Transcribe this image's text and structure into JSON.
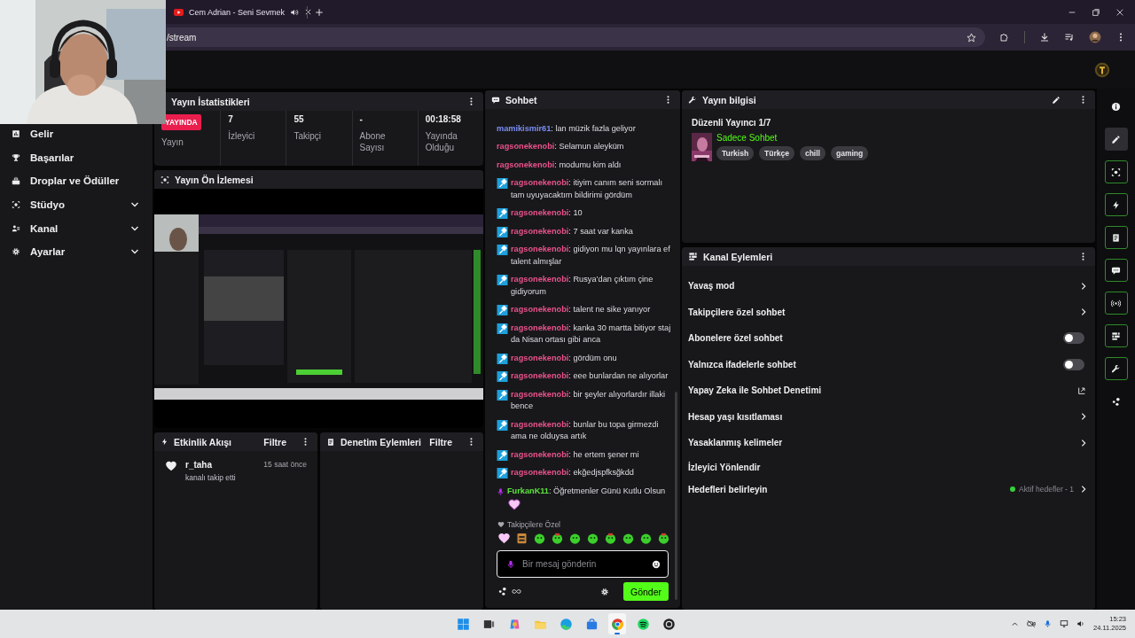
{
  "browser": {
    "tab": {
      "title": "Cem Adrian - Seni Sevmek",
      "audio": true
    },
    "address": "/stream"
  },
  "sidebar": {
    "items": [
      {
        "label": "Gelir",
        "expandable": false
      },
      {
        "label": "Başarılar",
        "expandable": false
      },
      {
        "label": "Droplar ve Ödüller",
        "expandable": false
      },
      {
        "label": "Stüdyo",
        "expandable": true
      },
      {
        "label": "Kanal",
        "expandable": true
      },
      {
        "label": "Ayarlar",
        "expandable": true
      }
    ]
  },
  "stats": {
    "title": "Yayın İstatistikleri",
    "items": [
      {
        "kind": "live",
        "value": "YAYINDA",
        "label": "Yayın"
      },
      {
        "kind": "number",
        "value": "7",
        "label": "İzleyici"
      },
      {
        "kind": "number",
        "value": "55",
        "label": "Takipçi"
      },
      {
        "kind": "number",
        "value": "-",
        "label": "Abone Sayısı"
      },
      {
        "kind": "number",
        "value": "00:18:58",
        "label": "Yayında Olduğu"
      }
    ]
  },
  "preview": {
    "title": "Yayın Ön İzlemesi"
  },
  "activity": {
    "title": "Etkinlik Akışı",
    "filter": "Filtre",
    "events": [
      {
        "user": "r_taha",
        "time": "15 saat önce",
        "text": "kanalı takip etti"
      }
    ]
  },
  "moderation": {
    "title": "Denetim Eylemleri",
    "filter": "Filtre"
  },
  "chat": {
    "title": "Sohbet",
    "messages": [
      {
        "kind": "plain",
        "user": "mamikismir61",
        "color": "#7b8df0",
        "text": ": lan müzik fazla geliyor",
        "emote": false
      },
      {
        "kind": "plain",
        "user": "ragsonekenobi",
        "color": "#e8528a",
        "text": ": Selamun aleyküm",
        "emote": false
      },
      {
        "kind": "plain",
        "user": "ragsonekenobi",
        "color": "#e8528a",
        "text": ": modumu kim aldı",
        "emote": false
      },
      {
        "kind": "mod",
        "user": "ragsonekenobi",
        "color": "#e8528a",
        "text": ": itiyim canım seni sormalı tam uyuyacaktım bildirimi gördüm",
        "emote": false
      },
      {
        "kind": "mod",
        "user": "ragsonekenobi",
        "color": "#e8528a",
        "text": ": 10",
        "emote": false
      },
      {
        "kind": "mod",
        "user": "ragsonekenobi",
        "color": "#e8528a",
        "text": ": 7 saat var kanka",
        "emote": false
      },
      {
        "kind": "mod",
        "user": "ragsonekenobi",
        "color": "#e8528a",
        "text": ": gidiyon mu lqn yayınlara ef talent almışlar",
        "emote": false
      },
      {
        "kind": "mod",
        "user": "ragsonekenobi",
        "color": "#e8528a",
        "text": ": Rusya’dan çıktım çine gidiyorum",
        "emote": false
      },
      {
        "kind": "mod",
        "user": "ragsonekenobi",
        "color": "#e8528a",
        "text": ": talent ne sike yanıyor",
        "emote": false
      },
      {
        "kind": "mod",
        "user": "ragsonekenobi",
        "color": "#e8528a",
        "text": ": kanka 30 martta bitiyor staj da Nisan ortası gibi anca",
        "emote": false
      },
      {
        "kind": "mod",
        "user": "ragsonekenobi",
        "color": "#e8528a",
        "text": ": gördüm onu",
        "emote": false
      },
      {
        "kind": "mod",
        "user": "ragsonekenobi",
        "color": "#e8528a",
        "text": ": eee bunlardan ne alıyorlar",
        "emote": false
      },
      {
        "kind": "mod",
        "user": "ragsonekenobi",
        "color": "#e8528a",
        "text": ": bir şeyler alıyorlardır illaki bence",
        "emote": false
      },
      {
        "kind": "mod",
        "user": "ragsonekenobi",
        "color": "#e8528a",
        "text": ": bunlar bu topa girmezdi ama ne olduysa artık",
        "emote": false
      },
      {
        "kind": "mod",
        "user": "ragsonekenobi",
        "color": "#e8528a",
        "text": ": he ertem şener mi",
        "emote": false
      },
      {
        "kind": "mod",
        "user": "ragsonekenobi",
        "color": "#e8528a",
        "text": ": ekğedjspfksğkdd",
        "emote": false
      },
      {
        "kind": "vip",
        "user": "FurkanK11",
        "color": "#5ee33f",
        "text": ": Öğretmenler Günü Kutlu Olsun",
        "emote": true
      }
    ],
    "emote_section": "Takipçilere Özel",
    "input": {
      "placeholder": "Bir mesaj gönderin"
    },
    "send": "Gönder"
  },
  "info": {
    "title": "Yayın bilgisi",
    "stream_title": "Düzenli Yayıncı 1/7",
    "category": "Sadece Sohbet",
    "tags": [
      "Turkish",
      "Türkçe",
      "chill",
      "gaming"
    ]
  },
  "actions": {
    "title": "Kanal Eylemleri",
    "rows": [
      {
        "kind": "link",
        "label": "Yavaş mod"
      },
      {
        "kind": "link",
        "label": "Takipçilere özel sohbet"
      },
      {
        "kind": "toggle",
        "label": "Abonelere özel sohbet",
        "on": false
      },
      {
        "kind": "toggle",
        "label": "Yalnızca ifadelerle sohbet",
        "on": false
      },
      {
        "kind": "external",
        "label": "Yapay Zeka ile Sohbet Denetimi"
      },
      {
        "kind": "link",
        "label": "Hesap yaşı kısıtlaması"
      },
      {
        "kind": "link",
        "label": "Yasaklanmış kelimeler"
      },
      {
        "kind": "plain",
        "label": "İzleyici Yönlendir"
      },
      {
        "kind": "goal",
        "label": "Hedefleri belirleyin",
        "status": "Aktif hedefler - 1"
      }
    ]
  },
  "rail": [
    {
      "selected": false,
      "framed": false
    },
    {
      "selected": true,
      "framed": false
    },
    {
      "selected": false,
      "framed": true
    },
    {
      "selected": false,
      "framed": true
    },
    {
      "selected": false,
      "framed": true
    },
    {
      "selected": false,
      "framed": true
    },
    {
      "selected": false,
      "framed": true
    },
    {
      "selected": false,
      "framed": true
    },
    {
      "selected": false,
      "framed": true
    },
    {
      "selected": false,
      "framed": false
    }
  ],
  "taskbar": {
    "apps": [
      {
        "selected": false
      },
      {
        "selected": false
      },
      {
        "selected": false
      },
      {
        "selected": false
      },
      {
        "selected": false
      },
      {
        "selected": false
      },
      {
        "selected": true
      },
      {
        "selected": false
      },
      {
        "selected": false
      }
    ],
    "time": "15:23",
    "date": "24.11.2025"
  }
}
